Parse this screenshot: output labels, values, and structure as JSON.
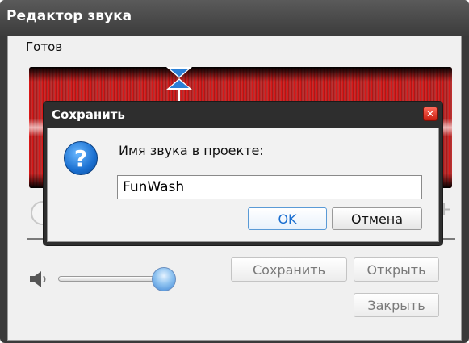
{
  "window": {
    "title": "Редактор звука",
    "status": "Готов"
  },
  "controls": {
    "save_label": "Сохранить",
    "open_label": "Открыть",
    "close_label": "Закрыть",
    "volume_level_percent": 95
  },
  "dialog": {
    "title": "Сохранить",
    "close_glyph": "✕",
    "icon": "question-icon",
    "icon_glyph": "?",
    "prompt": "Имя звука в проекте:",
    "input_value": "FunWash",
    "ok_label": "OK",
    "cancel_label": "Отмена"
  },
  "colors": {
    "waveform": "#e01010",
    "accent": "#1a6ed0"
  }
}
